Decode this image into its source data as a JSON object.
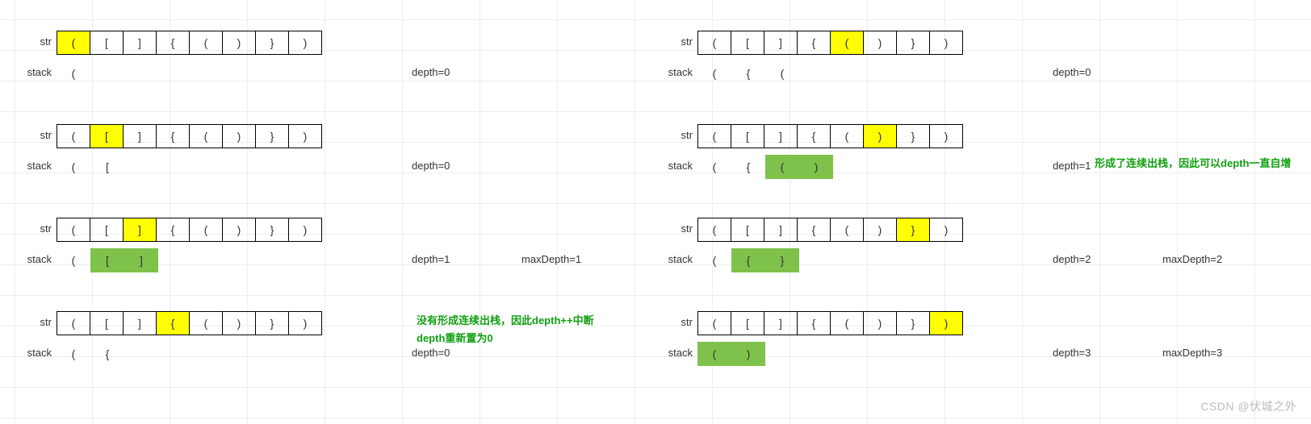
{
  "labels": {
    "str": "str",
    "stack": "stack"
  },
  "depth_prefix": "depth=",
  "maxdepth_prefix": "maxDepth=",
  "watermark": "CSDN @伏城之外",
  "left": {
    "note": "没有形成连续出栈，因此depth++中断\ndepth重新置为0",
    "steps": [
      {
        "str": [
          "(",
          "[",
          "]",
          "{",
          "(",
          ")",
          "}",
          ")"
        ],
        "hl_str": [
          0
        ],
        "stack": [
          "("
        ],
        "hl_stack": [],
        "depth": 0,
        "maxDepth": null
      },
      {
        "str": [
          "(",
          "[",
          "]",
          "{",
          "(",
          ")",
          "}",
          ")"
        ],
        "hl_str": [
          1
        ],
        "stack": [
          "(",
          "["
        ],
        "hl_stack": [],
        "depth": 0,
        "maxDepth": null
      },
      {
        "str": [
          "(",
          "[",
          "]",
          "{",
          "(",
          ")",
          "}",
          ")"
        ],
        "hl_str": [
          2
        ],
        "stack": [
          "(",
          "[",
          "]"
        ],
        "hl_stack": [
          1,
          2
        ],
        "depth": 1,
        "maxDepth": 1
      },
      {
        "str": [
          "(",
          "[",
          "]",
          "{",
          "(",
          ")",
          "}",
          ")"
        ],
        "hl_str": [
          3
        ],
        "stack": [
          "(",
          "{"
        ],
        "hl_stack": [],
        "depth": 0,
        "maxDepth": null
      }
    ]
  },
  "right": {
    "note": "形成了连续出栈，因此可以depth一直自增",
    "steps": [
      {
        "str": [
          "(",
          "[",
          "]",
          "{",
          "(",
          ")",
          "}",
          ")"
        ],
        "hl_str": [
          4
        ],
        "stack": [
          "(",
          "{",
          "("
        ],
        "hl_stack": [],
        "depth": 0,
        "maxDepth": null
      },
      {
        "str": [
          "(",
          "[",
          "]",
          "{",
          "(",
          ")",
          "}",
          ")"
        ],
        "hl_str": [
          5
        ],
        "stack": [
          "(",
          "{",
          "(",
          ")"
        ],
        "hl_stack": [
          2,
          3
        ],
        "depth": 1,
        "maxDepth": null
      },
      {
        "str": [
          "(",
          "[",
          "]",
          "{",
          "(",
          ")",
          "}",
          ")"
        ],
        "hl_str": [
          6
        ],
        "stack": [
          "(",
          "{",
          "}"
        ],
        "hl_stack": [
          1,
          2
        ],
        "depth": 2,
        "maxDepth": 2
      },
      {
        "str": [
          "(",
          "[",
          "]",
          "{",
          "(",
          ")",
          "}",
          ")"
        ],
        "hl_str": [
          7
        ],
        "stack": [
          "(",
          ")"
        ],
        "hl_stack": [
          0,
          1
        ],
        "depth": 3,
        "maxDepth": 3
      }
    ]
  },
  "chart_data": {
    "type": "table",
    "title": "Bracket matching stack trace with depth",
    "input_string": "([]{()})",
    "left_column": [
      {
        "index": 0,
        "char": "(",
        "stack_after": [
          "("
        ],
        "depth": 0
      },
      {
        "index": 1,
        "char": "[",
        "stack_after": [
          "(",
          "["
        ],
        "depth": 0
      },
      {
        "index": 2,
        "char": "]",
        "stack_after": [
          "("
        ],
        "depth": 1,
        "maxDepth": 1,
        "popped_pair": "[]"
      },
      {
        "index": 3,
        "char": "{",
        "stack_after": [
          "(",
          "{"
        ],
        "depth": 0,
        "annotation": "没有形成连续出栈，因此depth++中断 depth重新置为0"
      }
    ],
    "right_column": [
      {
        "index": 4,
        "char": "(",
        "stack_after": [
          "(",
          "{",
          "("
        ],
        "depth": 0
      },
      {
        "index": 5,
        "char": ")",
        "stack_after": [
          "(",
          "{"
        ],
        "depth": 1,
        "popped_pair": "()",
        "annotation": "形成了连续出栈，因此可以depth一直自增"
      },
      {
        "index": 6,
        "char": "}",
        "stack_after": [
          "("
        ],
        "depth": 2,
        "maxDepth": 2,
        "popped_pair": "{}"
      },
      {
        "index": 7,
        "char": ")",
        "stack_after": [],
        "depth": 3,
        "maxDepth": 3,
        "popped_pair": "()"
      }
    ]
  }
}
